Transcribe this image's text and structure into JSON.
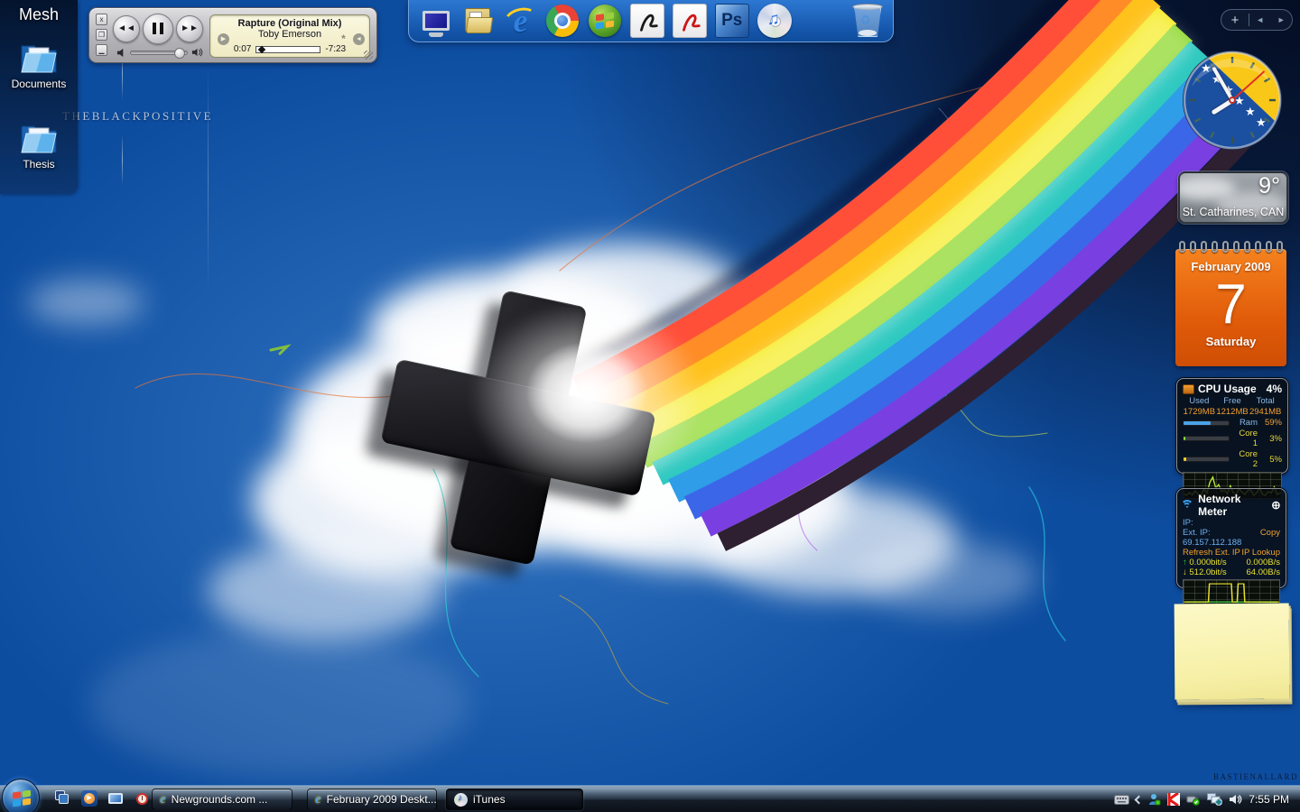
{
  "wallpaper": {
    "brand_text": "THEBLACKPOSITIVE",
    "credit_text": "BASTIENALLARD",
    "rainbow_stripes": [
      "#ff4f38",
      "#ff8c26",
      "#ffc21c",
      "#f6ec2c",
      "#8fd82e",
      "#2fc9c0",
      "#2f9de8",
      "#3c66e8",
      "#7a3fe0",
      "#2e2030"
    ]
  },
  "mesh_panel": {
    "title": "Mesh",
    "items": [
      {
        "label": "Documents"
      },
      {
        "label": "Thesis"
      }
    ]
  },
  "player": {
    "song_title": "Rapture (Original Mix)",
    "artist": "Toby Emerson",
    "elapsed": "0:07",
    "remaining": "-7:23",
    "close_glyph": "x"
  },
  "dock": {
    "icons": [
      "computer",
      "folders",
      "internet-explorer",
      "chrome",
      "windows",
      "acrobat-black",
      "acrobat-red",
      "photoshop",
      "itunes",
      "recycle-bin"
    ],
    "photoshop_label": "Ps"
  },
  "gadget_controls": {
    "add_label": "+",
    "prev_glyph": "◄",
    "next_glyph": "►"
  },
  "clock": {
    "hour_angle": 237.5,
    "minute_angle": 330,
    "second_angle": 48
  },
  "weather": {
    "temperature": "9°",
    "location": "St. Catharines, CAN"
  },
  "calendar": {
    "month_year": "February 2009",
    "day": "7",
    "weekday": "Saturday"
  },
  "cpu": {
    "title": "CPU Usage",
    "usage": "4%",
    "columns": [
      "Used",
      "Free",
      "Total"
    ],
    "values": [
      "1729MB",
      "1212MB",
      "2941MB"
    ],
    "rows": [
      {
        "label": "Ram",
        "percent": "59%",
        "fill": 59,
        "color": "#4aa3e8",
        "label_color": "#8ab8e8",
        "pct_color": "#f0a030"
      },
      {
        "label": "Core 1",
        "percent": "3%",
        "fill": 4,
        "color": "#8ae234",
        "label_color": "#e8d838",
        "pct_color": "#e8d838"
      },
      {
        "label": "Core 2",
        "percent": "5%",
        "fill": 6,
        "color": "#f2d024",
        "label_color": "#e8d838",
        "pct_color": "#e8d838"
      }
    ],
    "graph": [
      [
        0,
        15
      ],
      [
        3,
        8
      ],
      [
        6,
        20
      ],
      [
        9,
        10
      ],
      [
        12,
        28
      ],
      [
        15,
        12
      ],
      [
        18,
        10
      ],
      [
        21,
        35
      ],
      [
        24,
        18
      ],
      [
        27,
        65
      ],
      [
        30,
        88
      ],
      [
        33,
        40
      ],
      [
        36,
        55
      ],
      [
        39,
        25
      ],
      [
        42,
        32
      ],
      [
        45,
        15
      ],
      [
        48,
        50
      ],
      [
        51,
        20
      ],
      [
        54,
        12
      ],
      [
        57,
        38
      ],
      [
        60,
        22
      ],
      [
        63,
        12
      ],
      [
        66,
        30
      ],
      [
        69,
        32
      ],
      [
        72,
        8
      ],
      [
        75,
        18
      ],
      [
        78,
        42
      ],
      [
        81,
        12
      ],
      [
        84,
        8
      ],
      [
        87,
        25
      ],
      [
        90,
        18
      ],
      [
        93,
        45
      ],
      [
        96,
        12
      ],
      [
        100,
        20
      ]
    ]
  },
  "network": {
    "title": "Network Meter",
    "ip_label": "IP:",
    "ext_ip": "Ext. IP: 69.157.112.188",
    "copy_label": "Copy",
    "refresh_label": "Refresh Ext. IP",
    "lookup_label": "IP Lookup",
    "up_glyph": "↑",
    "down_glyph": "↓",
    "up_rate": "0.000bit/s",
    "up_bytes": "0.000B/s",
    "down_rate": "512.0bit/s",
    "down_bytes": "64.00B/s",
    "graph": [
      [
        0,
        4
      ],
      [
        26,
        4
      ],
      [
        27,
        90
      ],
      [
        50,
        90
      ],
      [
        51,
        4
      ],
      [
        56,
        4
      ],
      [
        57,
        90
      ],
      [
        63,
        90
      ],
      [
        64,
        4
      ],
      [
        100,
        4
      ]
    ]
  },
  "taskbar": {
    "buttons": [
      {
        "label": "Newgrounds.com ...",
        "icon": "internet-explorer"
      },
      {
        "label": "February 2009 Deskt...",
        "icon": "internet-explorer"
      },
      {
        "label": "iTunes",
        "icon": "itunes"
      }
    ],
    "tray_time": "7:55 PM"
  }
}
